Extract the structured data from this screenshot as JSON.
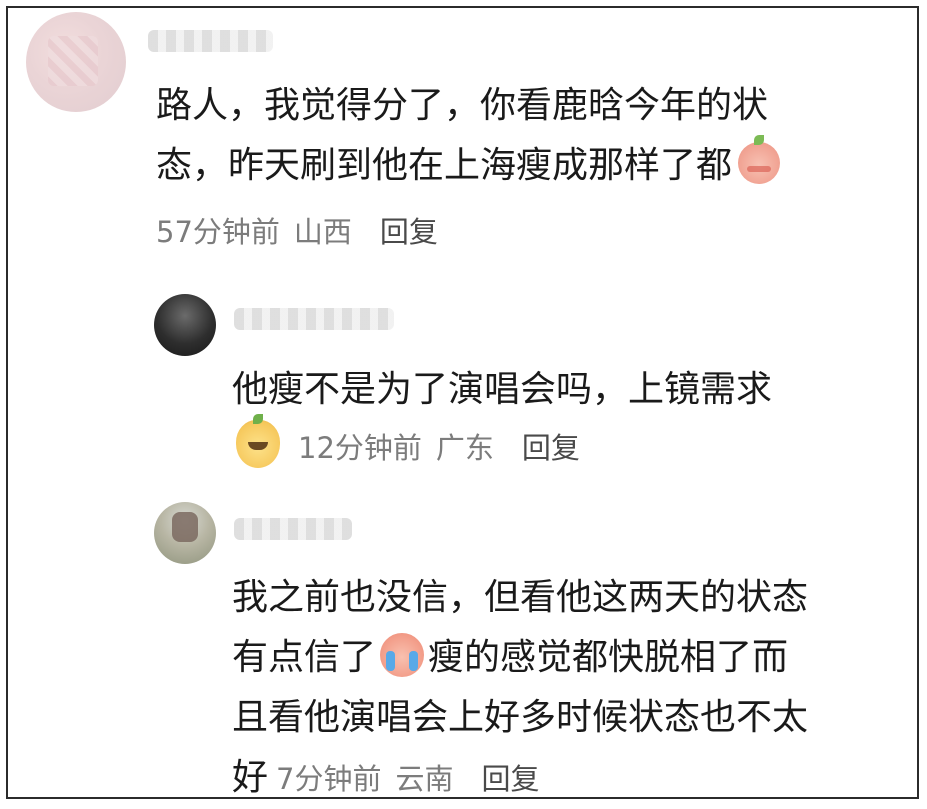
{
  "comments": [
    {
      "text_line1": "路人，我觉得分了，你看鹿晗今年的状",
      "text_line2": "态，昨天刷到他在上海瘦成那样了都",
      "emoji": "blush-emoji",
      "time": "57分钟前",
      "location": "山西",
      "reply": "回复"
    }
  ],
  "replies": [
    {
      "text": "他瘦不是为了演唱会吗，上镜需求",
      "emoji": "dog-emoji",
      "time": "12分钟前",
      "location": "广东",
      "reply": "回复"
    },
    {
      "text_line1": "我之前也没信，但看他这两天的状态",
      "text_line2a": "有点信了",
      "emoji": "crying-emoji",
      "text_line2b": "瘦的感觉都快脱相了而",
      "text_line3": "且看他演唱会上好多时候状态也不太",
      "text_line4": "好",
      "time": "7分钟前",
      "location": "云南",
      "reply": "回复"
    }
  ]
}
